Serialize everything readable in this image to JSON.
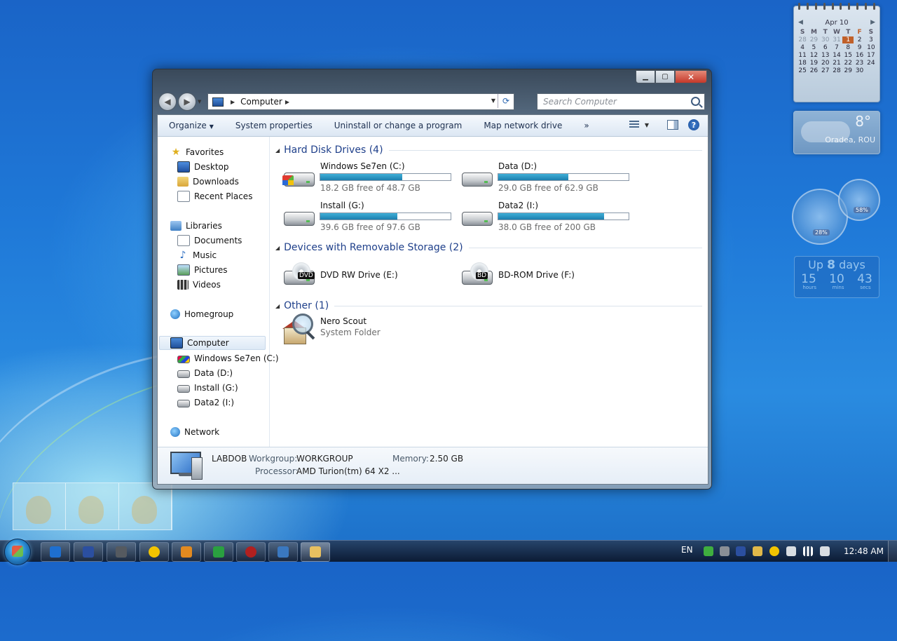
{
  "desktop": {
    "calendar": {
      "month": "Apr 10",
      "weekdays": [
        "S",
        "M",
        "T",
        "W",
        "T",
        "F",
        "S"
      ],
      "weeks": [
        [
          "28",
          "29",
          "30",
          "31",
          "1",
          "2",
          "3"
        ],
        [
          "4",
          "5",
          "6",
          "7",
          "8",
          "9",
          "10"
        ],
        [
          "11",
          "12",
          "13",
          "14",
          "15",
          "16",
          "17"
        ],
        [
          "18",
          "19",
          "20",
          "21",
          "22",
          "23",
          "24"
        ],
        [
          "25",
          "26",
          "27",
          "28",
          "29",
          "30",
          ""
        ]
      ]
    },
    "weather": {
      "temp": "8°",
      "city": "Oradea, ROU"
    },
    "meters": {
      "cpu": "28%",
      "memory": "58%"
    },
    "uptime": {
      "prefix": "Up",
      "days": "8",
      "days_label": "days",
      "hours": "15",
      "mins": "10",
      "secs": "43",
      "hours_label": "hours",
      "mins_label": "mins",
      "secs_label": "secs"
    }
  },
  "window": {
    "address": {
      "crumb": "Computer"
    },
    "search": {
      "placeholder": "Search Computer"
    },
    "toolbar": {
      "organize": "Organize",
      "system_properties": "System properties",
      "uninstall": "Uninstall or change a program",
      "map_drive": "Map network drive",
      "more": "»"
    },
    "nav": {
      "favorites": "Favorites",
      "desktop": "Desktop",
      "downloads": "Downloads",
      "recent": "Recent Places",
      "libraries": "Libraries",
      "documents": "Documents",
      "music": "Music",
      "pictures": "Pictures",
      "videos": "Videos",
      "homegroup": "Homegroup",
      "computer": "Computer",
      "drive_c": "Windows Se7en (C:)",
      "drive_d": "Data (D:)",
      "drive_g": "Install (G:)",
      "drive_i": "Data2 (I:)",
      "network": "Network"
    },
    "groups": {
      "hdd": "Hard Disk Drives (4)",
      "removable": "Devices with Removable Storage (2)",
      "other": "Other (1)"
    },
    "drives": [
      {
        "name": "Windows Se7en (C:)",
        "free": "18.2 GB free of 48.7 GB",
        "used_fraction": 0.63
      },
      {
        "name": "Data (D:)",
        "free": "29.0 GB free of 62.9 GB",
        "used_fraction": 0.54
      },
      {
        "name": "Install (G:)",
        "free": "39.6 GB free of 97.6 GB",
        "used_fraction": 0.59
      },
      {
        "name": "Data2 (I:)",
        "free": "38.0 GB free of 200 GB",
        "used_fraction": 0.81
      }
    ],
    "removable": [
      {
        "name": "DVD RW Drive (E:)",
        "badge": "DVD"
      },
      {
        "name": "BD-ROM Drive (F:)",
        "badge": "BD"
      }
    ],
    "other": {
      "name": "Nero Scout",
      "type": "System Folder"
    },
    "details": {
      "computer_name": "LABDOB",
      "workgroup_label": "Workgroup:",
      "workgroup": "WORKGROUP",
      "memory_label": "Memory:",
      "memory": "2.50 GB",
      "processor_label": "Processor:",
      "processor": "AMD Turion(tm) 64 X2 ..."
    }
  },
  "taskbar": {
    "language": "EN",
    "clock": "12:48 AM",
    "icon_colors": [
      "#1e6fd0",
      "#2b4fa0",
      "#555a60",
      "#f2c400",
      "#e28a20",
      "#2aa040",
      "#b02020",
      "#3a78c0",
      "#e8c060"
    ]
  }
}
